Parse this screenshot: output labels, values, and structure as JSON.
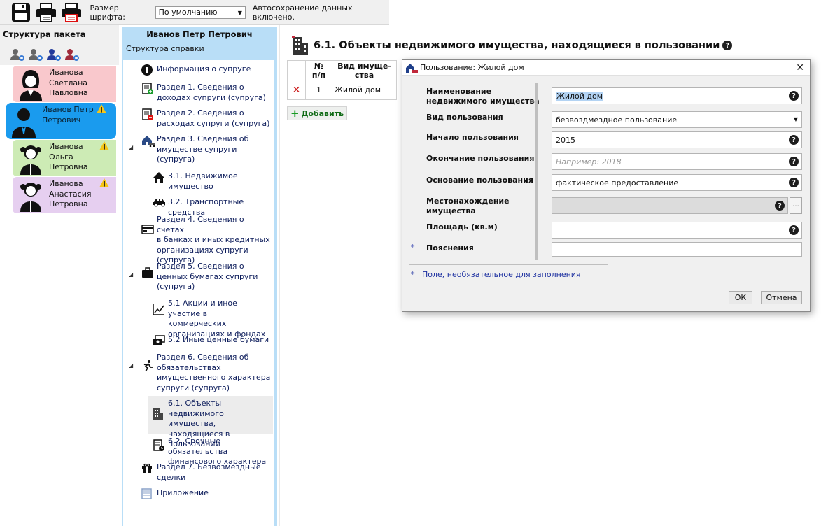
{
  "toolbar": {
    "font_size_label": "Размер шрифта:",
    "font_size_value": "По умолчанию",
    "autosave_text": "Автосохранение данных включено."
  },
  "package": {
    "title": "Структура пакета",
    "people": [
      {
        "name_lines": [
          "Иванова",
          "Светлана",
          "Павловна"
        ],
        "warning": false
      },
      {
        "name_lines": [
          "Иванов Петр",
          "Петрович"
        ],
        "warning": true
      },
      {
        "name_lines": [
          "Иванова",
          "Ольга",
          "Петровна"
        ],
        "warning": true
      },
      {
        "name_lines": [
          "Иванова",
          "Анастасия",
          "Петровна"
        ],
        "warning": true
      }
    ]
  },
  "tree": {
    "person": "Иванов Петр Петрович",
    "subtitle": "Структура справки",
    "nodes": [
      {
        "lines": [
          "Информация о супруге"
        ]
      },
      {
        "lines": [
          "Раздел 1. Сведения о",
          "доходах супруги (супруга)"
        ]
      },
      {
        "lines": [
          "Раздел 2. Сведения о",
          "расходах супруги (супруга)"
        ]
      },
      {
        "lines": [
          "Раздел 3. Сведения об",
          "имуществе супруги",
          "(супруга)"
        ]
      },
      {
        "lines": [
          "3.1. Недвижимое",
          "имущество"
        ]
      },
      {
        "lines": [
          "3.2. Транспортные средства"
        ]
      },
      {
        "lines": [
          "Раздел 4. Сведения о счетах",
          "в банках и иных кредитных",
          "организациях супруги",
          "(супруга)"
        ]
      },
      {
        "lines": [
          "Раздел 5. Сведения о",
          "ценных бумагах супруги",
          "(супруга)"
        ]
      },
      {
        "lines": [
          "5.1 Акции и иное участие в",
          "коммерческих",
          "организациях и фондах"
        ]
      },
      {
        "lines": [
          "5.2 Иные ценные бумаги"
        ]
      },
      {
        "lines": [
          "Раздел 6. Сведения об",
          "обязательствах",
          "имущественного характера",
          "супруги (супруга)"
        ]
      },
      {
        "lines": [
          "6.1. Объекты недвижимого",
          "имущества, находящиеся в",
          "пользовании"
        ]
      },
      {
        "lines": [
          "6.2. Срочные обязательства",
          "финансового характера"
        ]
      },
      {
        "lines": [
          "Раздел 7. Безвозмездные",
          "сделки"
        ]
      },
      {
        "lines": [
          "Приложение"
        ]
      }
    ]
  },
  "main": {
    "title": "6.1. Объекты недвижимого имущества, находящиеся в пользовании",
    "table": {
      "headers": [
        [
          "№",
          "п/п"
        ],
        [
          "Вид имуще-",
          "ства"
        ]
      ],
      "rows": [
        {
          "num": "1",
          "kind": "Жилой дом"
        }
      ]
    },
    "add_button": "Добавить"
  },
  "dialog": {
    "title": "Пользование: Жилой дом",
    "labels": {
      "name": [
        "Наименование",
        "недвижимого имущества"
      ],
      "usage_type": "Вид пользования",
      "start": "Начало пользования",
      "end": "Окончание пользования",
      "basis": "Основание пользования",
      "location": [
        "Местонахождение",
        "имущества"
      ],
      "area": "Площадь (кв.м)",
      "notes": "Пояснения"
    },
    "values": {
      "name": "Жилой дом",
      "usage_type": "безвоздмездное пользование",
      "start": "2015",
      "end_placeholder": "Например: 2018",
      "basis": "фактическое предоставление",
      "location": "",
      "area": "",
      "notes": ""
    },
    "required_mark": "*",
    "footnote": "*   Поле, необязательное для заполнения",
    "ok": "ОК",
    "cancel": "Отмена",
    "help_glyph": "?",
    "dots_glyph": "..."
  },
  "colors": {
    "person_1": "#f9c8cc",
    "person_selected": "#1a9bee",
    "person_3": "#cdebb5",
    "person_4": "#e6cff0",
    "tree_panel": "#b9def7",
    "add_green": "#199b25",
    "delete_red": "#cc1a1a"
  }
}
